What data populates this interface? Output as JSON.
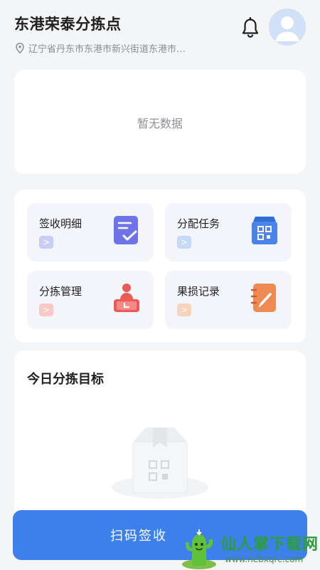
{
  "header": {
    "title": "东港荣泰分拣点",
    "address": "辽宁省丹东市东港市新兴街道东港市…",
    "icons": {
      "location": "location-pin-icon",
      "bell": "bell-icon",
      "avatar": "user-avatar-icon"
    }
  },
  "empty": {
    "text": "暂无数据"
  },
  "menu": {
    "items": [
      {
        "label": "签收明细",
        "icon": "document-check-icon",
        "arrow": ">",
        "accent": "#6f73e8"
      },
      {
        "label": "分配任务",
        "icon": "qr-box-icon",
        "arrow": ">",
        "accent": "#4a84ea"
      },
      {
        "label": "分拣管理",
        "icon": "sorting-person-icon",
        "arrow": ">",
        "accent": "#ec5a58"
      },
      {
        "label": "果损记录",
        "icon": "notebook-pen-icon",
        "arrow": ">",
        "accent": "#f08a54"
      }
    ]
  },
  "goal": {
    "title": "今日分拣目标"
  },
  "scan": {
    "label": "扫码签收"
  },
  "watermark": {
    "text": "仙人掌下载网",
    "url": "www.hebxqrc.com"
  },
  "colors": {
    "primary": "#3d80ec",
    "background": "#f4f5f7",
    "card": "#ffffff"
  }
}
